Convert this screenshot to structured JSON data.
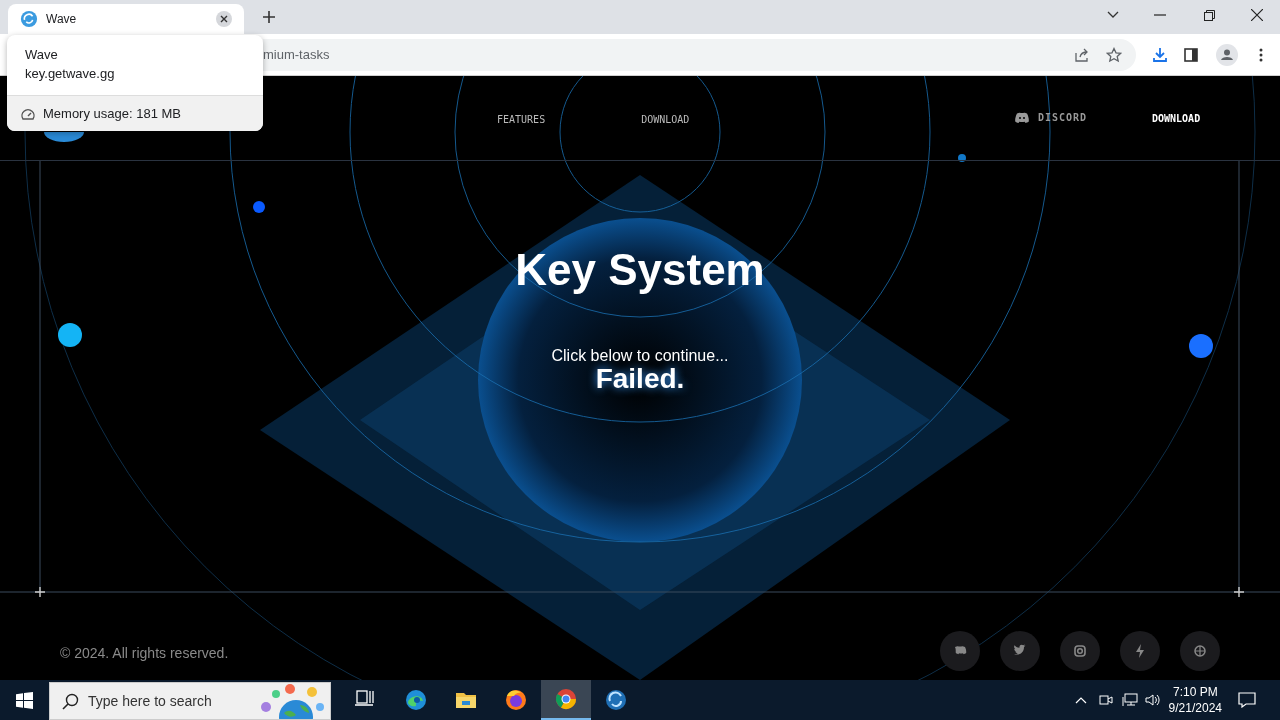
{
  "browser": {
    "tab_title": "Wave",
    "address": "mium-tasks",
    "hover_card": {
      "title": "Wave",
      "domain": "key.getwave.gg",
      "memory": "Memory usage: 181 MB"
    }
  },
  "nav": {
    "center_links": [
      "FEATURES",
      "DOWNLOAD"
    ],
    "discord": "DISCORD",
    "download": "DOWNLOAD"
  },
  "hero": {
    "title": "Key System",
    "subtitle": "Click below to continue...",
    "status": "Failed."
  },
  "footer": {
    "copyright": "© 2024. All rights reserved.",
    "socials": [
      {
        "kind": "discord"
      },
      {
        "kind": "twitter"
      },
      {
        "kind": "camera"
      },
      {
        "kind": "bolt"
      },
      {
        "kind": "globe"
      }
    ]
  },
  "taskbar": {
    "search_placeholder": "Type here to search",
    "apps": [
      {
        "kind": "taskview",
        "selected": false
      },
      {
        "kind": "edge",
        "selected": false
      },
      {
        "kind": "folder",
        "selected": false
      },
      {
        "kind": "firefox",
        "selected": false
      },
      {
        "kind": "chrome",
        "selected": true
      },
      {
        "kind": "wave",
        "selected": false
      }
    ],
    "time": "7:10 PM",
    "date": "9/21/2024"
  }
}
